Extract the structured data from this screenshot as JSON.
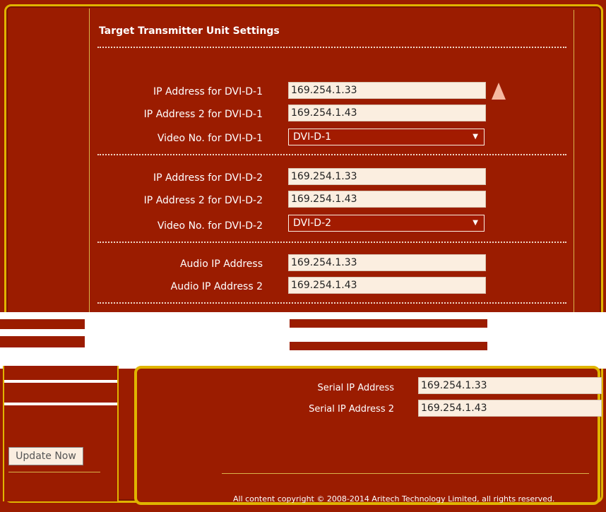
{
  "page": {
    "title": "Target Transmitter Unit Settings",
    "copyright": "All content copyright © 2008-2014 Aritech Technology Limited, all rights reserved."
  },
  "dvi1": {
    "ip_label": "IP Address for DVI-D-1",
    "ip_value": "169.254.1.33",
    "ip2_label": "IP Address 2 for DVI-D-1",
    "ip2_value": "169.254.1.43",
    "video_label": "Video No. for DVI-D-1",
    "video_value": "DVI-D-1"
  },
  "dvi2": {
    "ip_label": "IP Address for DVI-D-2",
    "ip_value": "169.254.1.33",
    "ip2_label": "IP Address 2 for DVI-D-2",
    "ip2_value": "169.254.1.43",
    "video_label": "Video No. for DVI-D-2",
    "video_value": "DVI-D-2"
  },
  "audio": {
    "ip_label": "Audio IP Address",
    "ip_value": "169.254.1.33",
    "ip2_label": "Audio IP Address 2",
    "ip2_value": "169.254.1.43"
  },
  "serial": {
    "ip_label": "Serial IP Address",
    "ip_value": "169.254.1.33",
    "ip2_label": "Serial IP Address 2",
    "ip2_value": "169.254.1.43"
  },
  "actions": {
    "update_label": "Update Now"
  },
  "colors": {
    "background": "#9b1c00",
    "accent": "#e0b400",
    "field": "#fbeee0"
  }
}
